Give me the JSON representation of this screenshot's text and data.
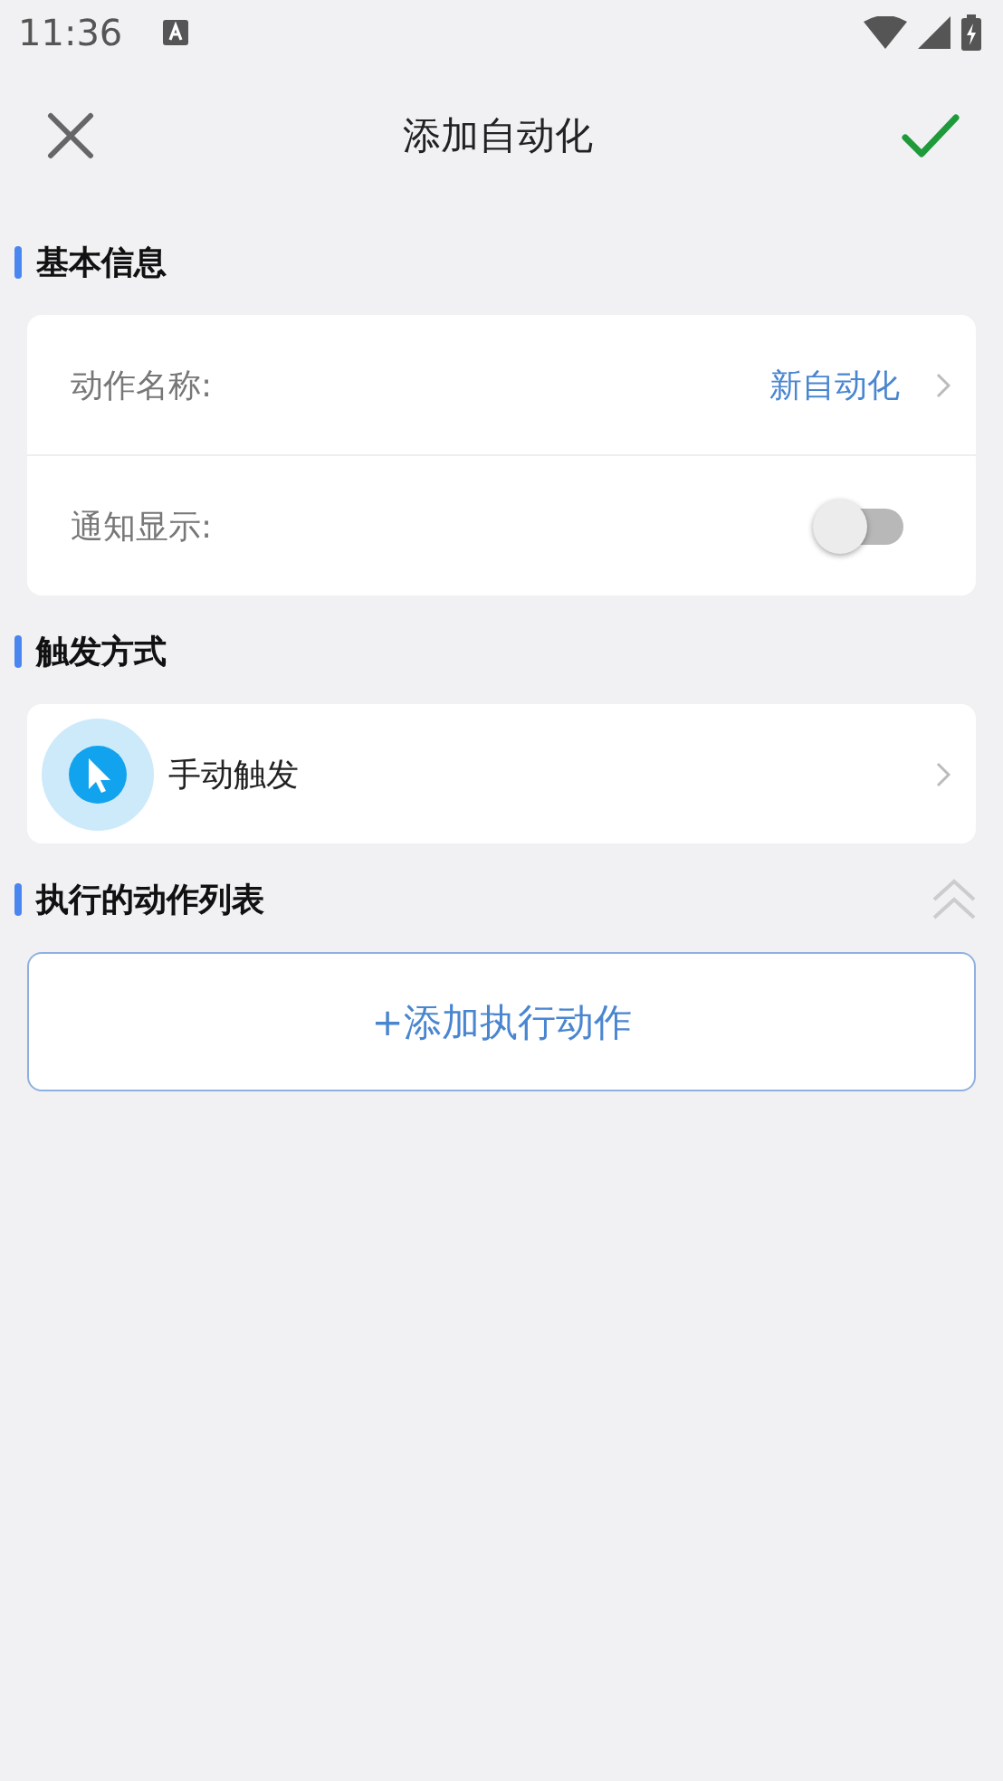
{
  "status_bar": {
    "time": "11:36"
  },
  "header": {
    "title": "添加自动化"
  },
  "sections": [
    {
      "kind": "fields",
      "title": "基本信息",
      "rows": [
        {
          "kind": "value",
          "label": "动作名称:",
          "value": "新自动化"
        },
        {
          "kind": "toggle",
          "label": "通知显示:",
          "on": false
        }
      ]
    },
    {
      "kind": "trigger",
      "title": "触发方式",
      "label": "手动触发"
    },
    {
      "kind": "actions",
      "title": "执行的动作列表",
      "button": "+添加执行动作"
    }
  ]
}
